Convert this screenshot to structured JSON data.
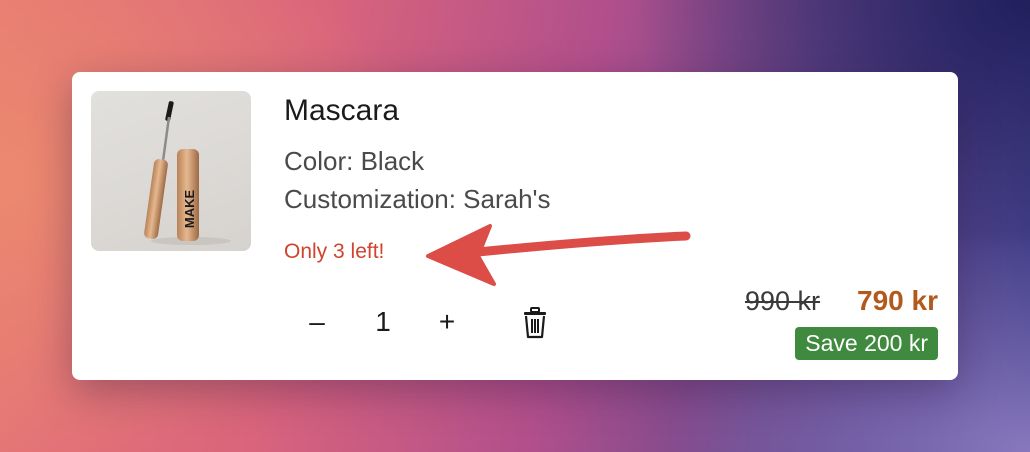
{
  "product": {
    "title": "Mascara",
    "color_line": "Color: Black",
    "customization_line": "Customization: Sarah's",
    "stock_notice": "Only 3 left!",
    "image_icon": "mascara-product-image",
    "brand_text": "MAKE"
  },
  "quantity": {
    "minus_label": "–",
    "value": "1",
    "plus_label": "+"
  },
  "actions": {
    "delete_icon": "trash-icon"
  },
  "pricing": {
    "original_price": "990 kr",
    "current_price": "790 kr",
    "savings_label": "Save 200 kr"
  },
  "colors": {
    "stock_notice": "#d0432e",
    "current_price": "#b25a1c",
    "savings_badge": "#3f8a3f",
    "annotation_arrow": "#dc4d48"
  }
}
